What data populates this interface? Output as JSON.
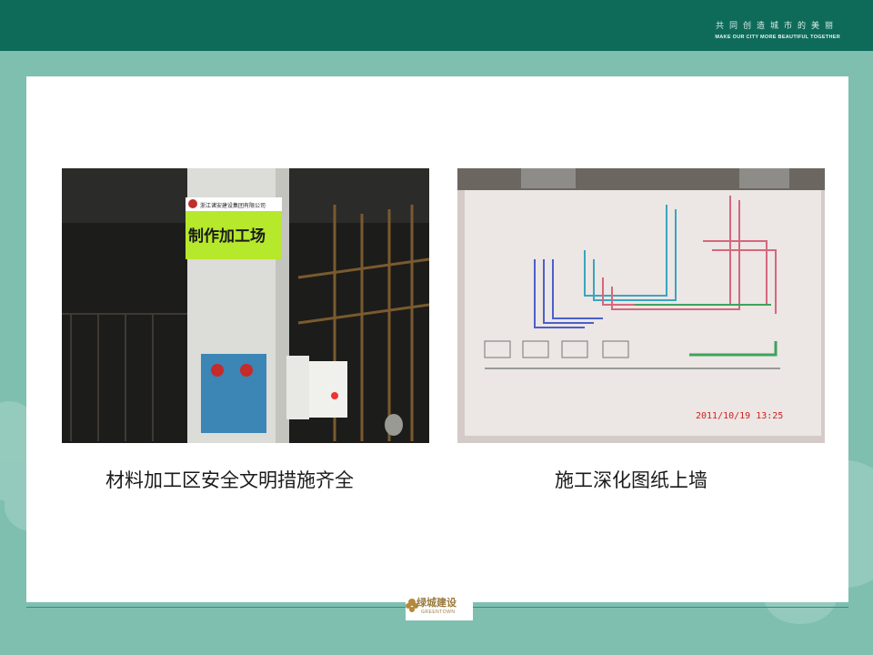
{
  "header": {
    "slogan_cn": "共同创造城市的美丽",
    "slogan_en": "MAKE OUR CITY MORE BEAUTIFUL TOGETHER"
  },
  "photos": {
    "left": {
      "sign_company": "浙江诸安建设集团有限公司",
      "sign_title": "制作加工场"
    },
    "right": {
      "timestamp": "2011/10/19  13:25"
    }
  },
  "captions": {
    "left": "材料加工区安全文明措施齐全",
    "right": "施工深化图纸上墙"
  },
  "footer": {
    "logo_cn": "绿城建设",
    "logo_en": "GREENTOWN"
  },
  "colors": {
    "header": "#0e6b5a",
    "background": "#7fbfb0",
    "accent_gold": "#9a7b3f"
  }
}
